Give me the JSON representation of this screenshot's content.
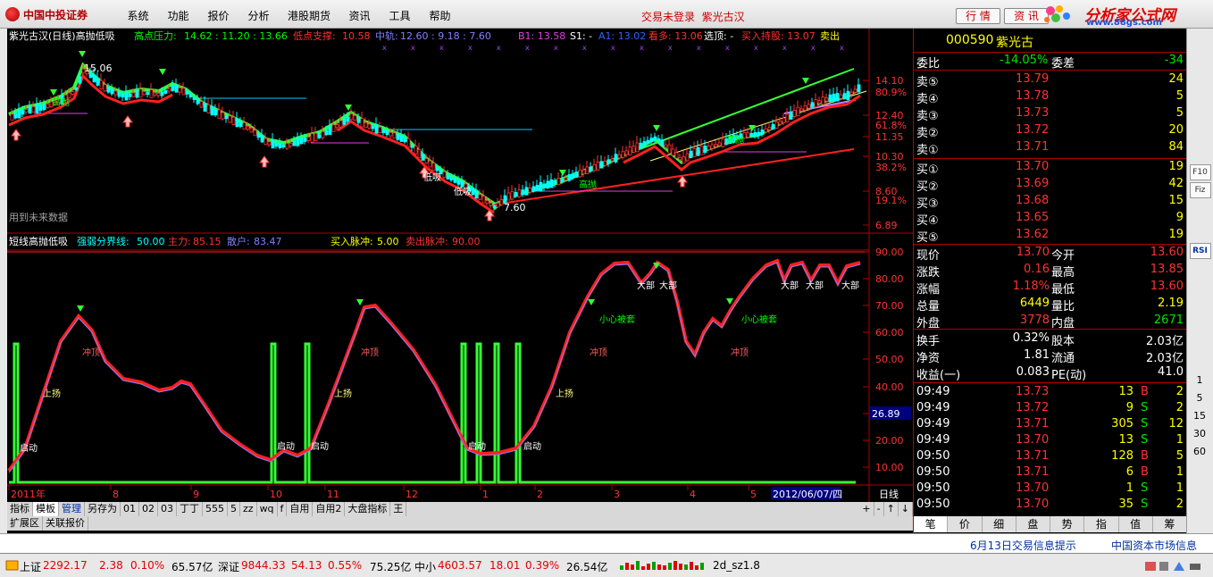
{
  "app": {
    "logo_text": "中国中投证券",
    "menus": [
      "系统",
      "功能",
      "报价",
      "分析",
      "港股期货",
      "资讯",
      "工具",
      "帮助"
    ],
    "login_status": "交易未登录",
    "stock_name": "紫光古汉",
    "quote_button": "行 情",
    "info_button": "资 讯",
    "brand_name": "分析家公式网",
    "brand_url": "www.88gs.com"
  },
  "main_chart": {
    "title": "紫光古汉(日线)高抛低吸",
    "high_label": "高点压力:",
    "high_vals": "14.62 : 11.20 : 13.66",
    "low_label": "低点支撑:",
    "low_val": "10.58",
    "mid_label": "中轨:",
    "mid_vals": "12.60 : 9.18 : 7.60",
    "b1": "B1: 13.58",
    "s1": "S1: -",
    "a1": "A1: 13.02",
    "duokong": "看多: 13.06",
    "xuanding": "选顶: -",
    "buyhold": "买入持股: 13.07",
    "sellout": "卖出",
    "peak_price": "15.06",
    "trough_price": "7.60",
    "future_note": "用到未来数据",
    "y_ticks": [
      "14.10",
      "12.40",
      "11.35",
      "10.30",
      "8.60",
      "6.89"
    ],
    "pct_ticks": [
      "80.9%",
      "61.8%",
      "38.2%",
      "19.1%"
    ],
    "annotations": {
      "gaopao": "高抛",
      "dixi": "低吸"
    }
  },
  "sub_chart": {
    "title": "短线高抛低吸",
    "strength_label": "强弱分界线:",
    "strength_val": "50.00",
    "main_force_label": "主力:",
    "main_force_val": "85.15",
    "retail_label": "散户:",
    "retail_val": "83.47",
    "buy_pulse_label": "买入脉冲:",
    "buy_pulse_val": "5.00",
    "sell_pulse_label": "卖出脉冲:",
    "sell_pulse_val": "90.00",
    "y_ticks": [
      "90.00",
      "80.00",
      "70.00",
      "60.00",
      "50.00",
      "40.00",
      "30.00",
      "20.00",
      "10.00"
    ],
    "cursor_val": "26.89",
    "labels": {
      "chongding": "冲顶",
      "shangyang": "上扬",
      "qidong": "启动",
      "dabu": "大部",
      "xiaoxin": "小心被套"
    }
  },
  "x_axis": {
    "labels": [
      "2011年",
      "8",
      "9",
      "10",
      "11",
      "12",
      "1",
      "2",
      "3",
      "4",
      "5"
    ],
    "cursor_date": "2012/06/07/四",
    "period": "日线",
    "controls": [
      "+",
      "-",
      "↑",
      "↓"
    ]
  },
  "toolbar1": [
    "指标",
    "模板",
    "管理",
    "另存为",
    "01",
    "02",
    "03",
    "丁丁",
    "555",
    "5",
    "zz",
    "wq",
    "f",
    "自用",
    "自用2",
    "大盘指标",
    "王"
  ],
  "toolbar2": [
    "扩展区",
    "关联报价"
  ],
  "stock": {
    "code": "000590",
    "name": "紫光古",
    "weibi_label": "委比",
    "weibi": "-14.05%",
    "weicha_label": "委差",
    "weicha": "-34",
    "asks": [
      {
        "label": "卖⑤",
        "price": "13.79",
        "vol": "24"
      },
      {
        "label": "卖④",
        "price": "13.78",
        "vol": "5"
      },
      {
        "label": "卖③",
        "price": "13.73",
        "vol": "5"
      },
      {
        "label": "卖②",
        "price": "13.72",
        "vol": "20"
      },
      {
        "label": "卖①",
        "price": "13.71",
        "vol": "84"
      }
    ],
    "bids": [
      {
        "label": "买①",
        "price": "13.70",
        "vol": "19"
      },
      {
        "label": "买②",
        "price": "13.69",
        "vol": "42"
      },
      {
        "label": "买③",
        "price": "13.68",
        "vol": "15"
      },
      {
        "label": "买④",
        "price": "13.65",
        "vol": "9"
      },
      {
        "label": "买⑤",
        "price": "13.62",
        "vol": "19"
      }
    ],
    "stats": [
      {
        "l1": "现价",
        "v1": "13.70",
        "l2": "今开",
        "v2": "13.60",
        "c1": "red",
        "c2": "red"
      },
      {
        "l1": "涨跌",
        "v1": "0.16",
        "l2": "最高",
        "v2": "13.85",
        "c1": "red",
        "c2": "red"
      },
      {
        "l1": "涨幅",
        "v1": "1.18%",
        "l2": "最低",
        "v2": "13.60",
        "c1": "red",
        "c2": "red"
      },
      {
        "l1": "总量",
        "v1": "6449",
        "l2": "量比",
        "v2": "2.19",
        "c1": "yellow",
        "c2": "yellow"
      },
      {
        "l1": "外盘",
        "v1": "3778",
        "l2": "内盘",
        "v2": "2671",
        "c1": "red",
        "c2": "green"
      }
    ],
    "stats2": [
      {
        "l1": "换手",
        "v1": "0.32%",
        "l2": "股本",
        "v2": "2.03亿"
      },
      {
        "l1": "净资",
        "v1": "1.81",
        "l2": "流通",
        "v2": "2.03亿"
      },
      {
        "l1": "收益(一)",
        "v1": "0.083",
        "l2": "PE(动)",
        "v2": "41.0"
      }
    ],
    "ticks": [
      {
        "time": "09:49",
        "price": "13.73",
        "vol": "13",
        "bs": "B",
        "n": "2"
      },
      {
        "time": "09:49",
        "price": "13.72",
        "vol": "9",
        "bs": "S",
        "n": "2"
      },
      {
        "time": "09:49",
        "price": "13.71",
        "vol": "305",
        "bs": "S",
        "n": "12"
      },
      {
        "time": "09:49",
        "price": "13.70",
        "vol": "13",
        "bs": "S",
        "n": "1"
      },
      {
        "time": "09:50",
        "price": "13.71",
        "vol": "128",
        "bs": "B",
        "n": "5"
      },
      {
        "time": "09:50",
        "price": "13.71",
        "vol": "6",
        "bs": "B",
        "n": "1"
      },
      {
        "time": "09:50",
        "price": "13.70",
        "vol": "1",
        "bs": "S",
        "n": "1"
      },
      {
        "time": "09:50",
        "price": "13.70",
        "vol": "35",
        "bs": "S",
        "n": "2"
      }
    ],
    "tabs": [
      "笔",
      "价",
      "细",
      "盘",
      "势",
      "指",
      "值",
      "筹"
    ]
  },
  "right_tools": [
    "F10",
    "Fiz",
    "RSI"
  ],
  "right_nums": [
    "1",
    "5",
    "15",
    "30",
    "60"
  ],
  "info": {
    "left": "6月13日交易信息提示",
    "right": "中国资本市场信息"
  },
  "status": {
    "sh_label": "上证",
    "sh_val": "2292.17",
    "sh_chg": "2.38",
    "sh_pct": "0.10%",
    "sh_amt": "65.57亿",
    "sz_label": "深证",
    "sz_val": "9844.33",
    "sz_chg": "54.13",
    "sz_pct": "0.55%",
    "sz_amt": "75.25亿",
    "zx_label": "中小",
    "zx_val": "4603.57",
    "zx_chg": "18.01",
    "zx_pct": "0.39%",
    "zx_amt": "26.54亿",
    "formula": "2d_sz1.8"
  },
  "colors": {
    "up": "#ff3232",
    "down": "#00e600",
    "ma": "#33ff33",
    "frame": "#b00000"
  }
}
